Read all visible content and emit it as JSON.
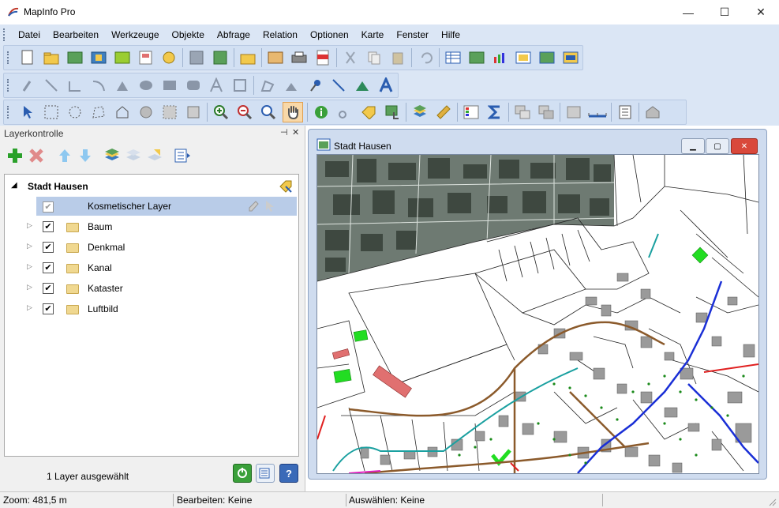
{
  "app": {
    "title": "MapInfo Pro"
  },
  "window_controls": {
    "minimize": "—",
    "maximize": "☐",
    "close": "✕"
  },
  "menu": [
    "Datei",
    "Bearbeiten",
    "Werkzeuge",
    "Objekte",
    "Abfrage",
    "Relation",
    "Optionen",
    "Karte",
    "Fenster",
    "Hilfe"
  ],
  "layer_panel": {
    "title": "Layerkontrolle",
    "pin": "📌",
    "close": "✕",
    "map_name": "Stadt Hausen",
    "cosmetic_layer": "Kosmetischer Layer",
    "layers": [
      "Baum",
      "Denkmal",
      "Kanal",
      "Kataster",
      "Luftbild"
    ],
    "selection_status": "1 Layer ausgewählt"
  },
  "map_window": {
    "title": "Stadt Hausen"
  },
  "statusbar": {
    "zoom": "Zoom: 481,5 m",
    "edit": "Bearbeiten: Keine",
    "select": "Auswählen: Keine"
  },
  "colors": {
    "ribbon": "#dbe6f5",
    "selection": "#b9cce8",
    "road_brown": "#8b5a2b",
    "river_blue": "#1a2fd6",
    "canal_teal": "#1aa0a0",
    "red_line": "#e02020",
    "green_area": "#22dd22"
  }
}
